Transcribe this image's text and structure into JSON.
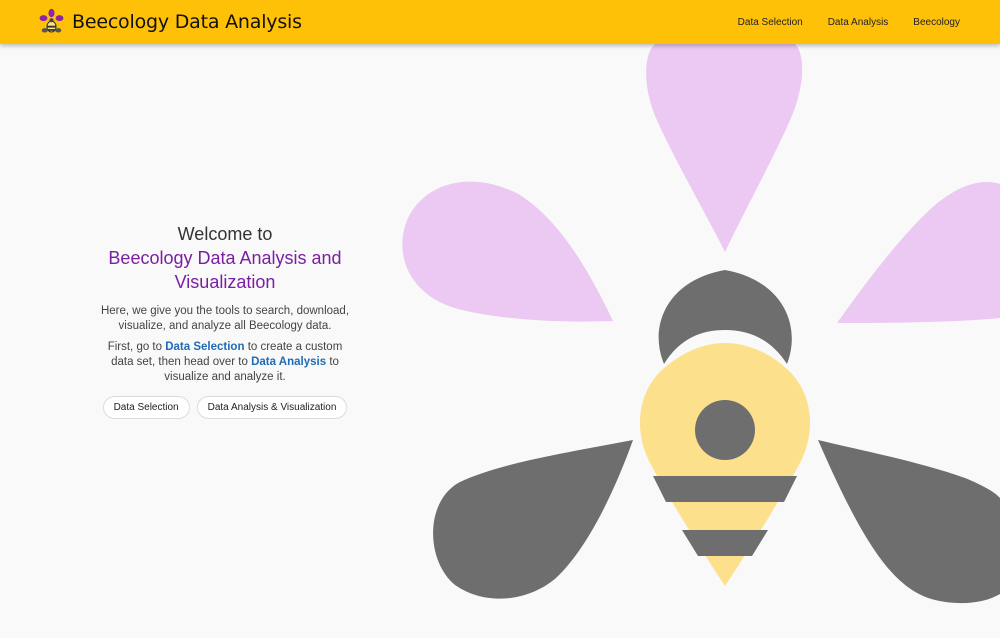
{
  "navbar": {
    "brand_title": "Beecology Data Analysis",
    "logo_icon": "bee-flower-logo",
    "links": [
      "Data Selection",
      "Data Analysis",
      "Beecology"
    ]
  },
  "welcome": {
    "intro": "Welcome to",
    "title": "Beecology Data Analysis and Visualization",
    "paragraph1": "Here, we give you the tools to search, download, visualize, and analyze all Beecology data.",
    "paragraph2": {
      "part1": "First, go to",
      "link1": "Data Selection",
      "part2": "to create a custom data set, then head over to",
      "link2": "Data Analysis",
      "part3": "to visualize and analyze it."
    },
    "buttons": {
      "data_selection": "Data Selection",
      "data_analysis_visualization": "Data Analysis & Visualization"
    }
  },
  "colors": {
    "navbar": "#ffc107",
    "accent_purple": "#7b1fa2",
    "link_blue": "#1e6bb8",
    "petal": "#ebc9f2",
    "bee_body": "#fde08b",
    "bee_gray": "#6e6e6e"
  },
  "hero_art_icon": "bee-on-flower-illustration"
}
